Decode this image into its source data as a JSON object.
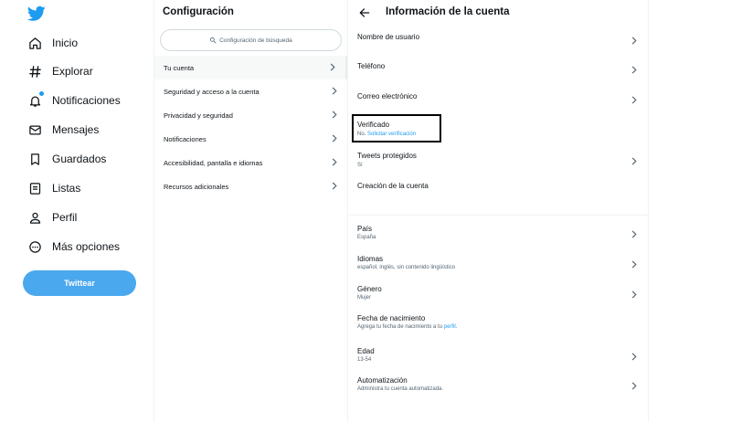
{
  "nav": {
    "items": [
      {
        "label": "Inicio",
        "icon": "home-icon"
      },
      {
        "label": "Explorar",
        "icon": "hashtag-icon"
      },
      {
        "label": "Notificaciones",
        "icon": "bell-icon"
      },
      {
        "label": "Mensajes",
        "icon": "envelope-icon"
      },
      {
        "label": "Guardados",
        "icon": "bookmark-icon"
      },
      {
        "label": "Listas",
        "icon": "list-icon"
      },
      {
        "label": "Perfil",
        "icon": "person-icon"
      },
      {
        "label": "Más opciones",
        "icon": "more-circle-icon"
      }
    ],
    "tweet_button": "Twittear"
  },
  "settings": {
    "title": "Configuración",
    "search_placeholder": "Configuración de búsqueda",
    "items": [
      {
        "label": "Tu cuenta"
      },
      {
        "label": "Seguridad y acceso a la cuenta"
      },
      {
        "label": "Privacidad y seguridad"
      },
      {
        "label": "Notificaciones"
      },
      {
        "label": "Accesibilidad, pantalla e idiomas"
      },
      {
        "label": "Recursos adicionales"
      }
    ]
  },
  "account": {
    "title": "Información de la cuenta",
    "username": {
      "title": "Nombre de usuario"
    },
    "phone": {
      "title": "Teléfono"
    },
    "email": {
      "title": "Correo electrónico"
    },
    "verified": {
      "title": "Verificado",
      "value": "No.",
      "link": "Solicitar verificación"
    },
    "protected": {
      "title": "Tweets protegidos",
      "value": "Sí"
    },
    "created": {
      "title": "Creación de la cuenta"
    },
    "country": {
      "title": "País",
      "value": "España"
    },
    "languages": {
      "title": "Idiomas",
      "value": "español, inglés, sin contenido lingüístico"
    },
    "gender": {
      "title": "Género",
      "value": "Mujer"
    },
    "birth": {
      "title": "Fecha de nacimiento",
      "value": "Agrega tu fecha de nacimiento a tu",
      "link": "perfil"
    },
    "age": {
      "title": "Edad",
      "value": "13-54"
    },
    "automation": {
      "title": "Automatización",
      "value": "Administra tu cuenta automatizada."
    }
  },
  "colors": {
    "accent": "#1d9bf0",
    "button": "#4aa8ee",
    "text": "#0f1419",
    "secondary": "#536471"
  }
}
